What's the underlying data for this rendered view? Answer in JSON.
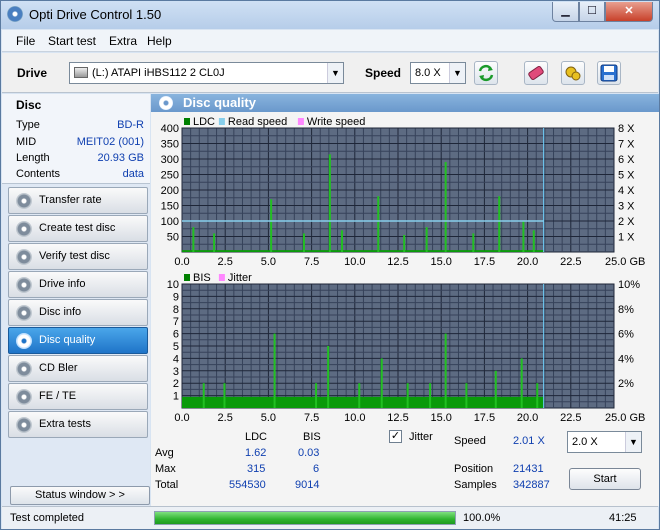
{
  "window": {
    "title": "Opti Drive Control 1.50"
  },
  "menu": [
    "File",
    "Start test",
    "Extra",
    "Help"
  ],
  "toolbar": {
    "drive_label": "Drive",
    "drive_value": "(L:)   ATAPI iHBS112   2 CL0J",
    "speed_label": "Speed",
    "speed_value": "8.0 X"
  },
  "disc": {
    "heading": "Disc",
    "rows": [
      {
        "key": "Type",
        "value": "BD-R"
      },
      {
        "key": "MID",
        "value": "MEIT02 (001)"
      },
      {
        "key": "Length",
        "value": "20.93 GB"
      },
      {
        "key": "Contents",
        "value": "data"
      }
    ]
  },
  "nav": [
    {
      "label": "Transfer rate",
      "active": false
    },
    {
      "label": "Create test disc",
      "active": false
    },
    {
      "label": "Verify test disc",
      "active": false
    },
    {
      "label": "Drive info",
      "active": false
    },
    {
      "label": "Disc info",
      "active": false
    },
    {
      "label": "Disc quality",
      "active": true
    },
    {
      "label": "CD Bler",
      "active": false
    },
    {
      "label": "FE / TE",
      "active": false
    },
    {
      "label": "Extra tests",
      "active": false
    }
  ],
  "status_window_label": "Status window > >",
  "panel_title": "Disc quality",
  "chart_data": [
    {
      "type": "bar",
      "legend": [
        "LDC",
        "Read speed",
        "Write speed"
      ],
      "legend_colors": [
        "#008000",
        "#87ceeb",
        "#ff88ff"
      ],
      "x_ticks": [
        "0.0",
        "2.5",
        "5.0",
        "7.5",
        "10.0",
        "12.5",
        "15.0",
        "17.5",
        "20.0",
        "22.5",
        "25.0 GB"
      ],
      "y_left_ticks": [
        "400",
        "350",
        "300",
        "250",
        "200",
        "150",
        "100",
        "50"
      ],
      "y_right_ticks": [
        "8 X",
        "7 X",
        "6 X",
        "5 X",
        "4 X",
        "3 X",
        "2 X",
        "1 X"
      ],
      "xlim": [
        0,
        25
      ],
      "ylim": [
        0,
        400
      ],
      "y2lim": [
        0,
        8
      ],
      "series": [
        {
          "name": "LDC",
          "x": [
            0.6,
            1.8,
            5.1,
            7.0,
            8.5,
            9.2,
            11.3,
            12.8,
            14.1,
            15.2,
            16.8,
            18.3,
            19.7,
            20.3
          ],
          "y": [
            80,
            60,
            170,
            60,
            315,
            70,
            180,
            55,
            80,
            290,
            60,
            180,
            100,
            70
          ]
        },
        {
          "name": "Read speed",
          "x": [
            0,
            20.93
          ],
          "y": [
            2.0,
            2.0
          ]
        }
      ]
    },
    {
      "type": "bar",
      "legend": [
        "BIS",
        "Jitter"
      ],
      "legend_colors": [
        "#008000",
        "#ff88ff"
      ],
      "x_ticks": [
        "0.0",
        "2.5",
        "5.0",
        "7.5",
        "10.0",
        "12.5",
        "15.0",
        "17.5",
        "20.0",
        "22.5",
        "25.0 GB"
      ],
      "y_left_ticks": [
        "10",
        "9",
        "8",
        "7",
        "6",
        "5",
        "4",
        "3",
        "2",
        "1"
      ],
      "y_right_ticks": [
        "10%",
        "8%",
        "6%",
        "4%",
        "2%"
      ],
      "xlim": [
        0,
        25
      ],
      "ylim": [
        0,
        10
      ],
      "y2lim": [
        0,
        10
      ],
      "series": [
        {
          "name": "BIS",
          "x": [
            1.2,
            2.4,
            5.3,
            7.7,
            8.4,
            10.2,
            11.5,
            13.0,
            14.3,
            15.2,
            16.4,
            18.1,
            19.6,
            20.5
          ],
          "y": [
            2,
            2,
            6,
            2,
            5,
            2,
            4,
            2,
            2,
            6,
            2,
            3,
            4,
            2
          ]
        }
      ]
    }
  ],
  "stats": {
    "col_ldc": "LDC",
    "col_bis": "BIS",
    "rows": [
      {
        "label": "Avg",
        "ldc": "1.62",
        "bis": "0.03"
      },
      {
        "label": "Max",
        "ldc": "315",
        "bis": "6"
      },
      {
        "label": "Total",
        "ldc": "554530",
        "bis": "9014"
      }
    ],
    "jitter_label": "Jitter",
    "speed_label": "Speed",
    "speed_value": "2.01 X",
    "speed_select": "2.0 X",
    "position_label": "Position",
    "position_value": "21431",
    "samples_label": "Samples",
    "samples_value": "342887",
    "start_label": "Start"
  },
  "statusbar": {
    "text": "Test completed",
    "progress": 100.0,
    "progress_text": "100.0%",
    "time": "41:25"
  }
}
